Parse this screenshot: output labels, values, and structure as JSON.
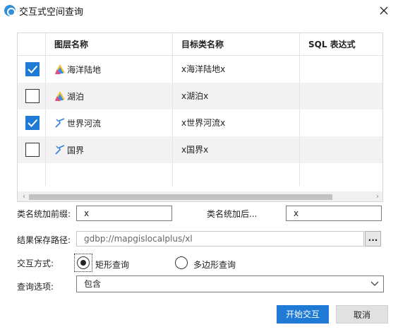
{
  "window": {
    "title": "交互式空间查询"
  },
  "table": {
    "headers": [
      "图层名称",
      "目标类名称",
      "SQL 表达式"
    ],
    "rows": [
      {
        "checked": true,
        "icon": "polygon-layer-icon",
        "layer": "海洋陆地",
        "target": "x海洋陆地x"
      },
      {
        "checked": false,
        "icon": "polygon-layer-icon",
        "layer": "湖泊",
        "target": "x湖泊x"
      },
      {
        "checked": true,
        "icon": "line-layer-icon",
        "layer": "世界河流",
        "target": "x世界河流x"
      },
      {
        "checked": false,
        "icon": "line-layer-icon",
        "layer": "国界",
        "target": "x国界x"
      }
    ]
  },
  "form": {
    "prefix_label": "类名统加前缀:",
    "prefix_value": "x",
    "suffix_label": "类名统加后...",
    "suffix_value": "x",
    "save_path_label": "结果保存路径:",
    "save_path_value": "gdbp://mapgislocalplus/xl",
    "browse_label": "...",
    "mode_label": "交互方式:",
    "mode_rect": "矩形查询",
    "mode_polygon": "多边形查询",
    "mode_selected": "矩形查询",
    "option_label": "查询选项:",
    "option_value": "包含"
  },
  "buttons": {
    "start": "开始交互",
    "cancel": "取消"
  },
  "colors": {
    "accent": "#1f7ad6",
    "row_alt": "#f2f2f2"
  }
}
